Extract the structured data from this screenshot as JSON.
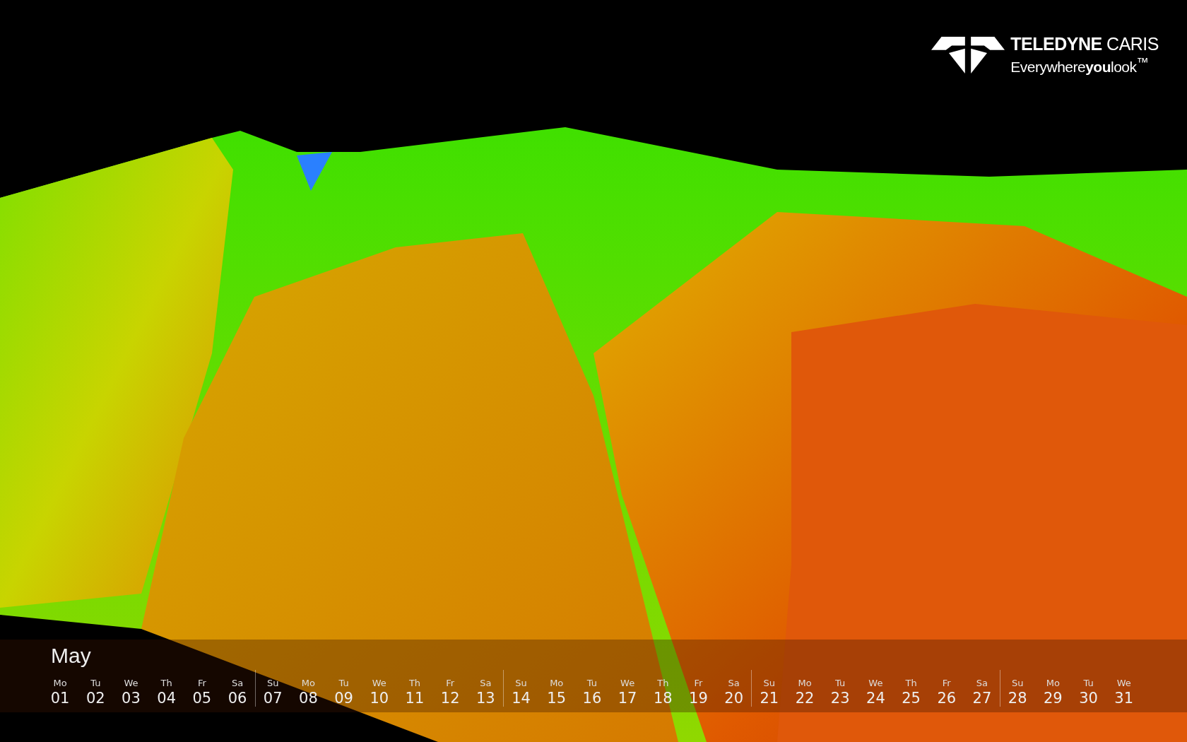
{
  "logo": {
    "name": "**TELEDYNE** CARIS",
    "tagline": "Everywhere**you**look$^{™}$"
  },
  "calendar": {
    "month": "May",
    "weeks": [
      {
        "days": [
          {
            "weekday": "Mo",
            "date": "01"
          },
          {
            "weekday": "Tu",
            "date": "02"
          },
          {
            "weekday": "We",
            "date": "03"
          },
          {
            "weekday": "Th",
            "date": "04"
          },
          {
            "weekday": "Fr",
            "date": "05"
          },
          {
            "weekday": "Sa",
            "date": "06"
          }
        ]
      },
      {
        "days": [
          {
            "weekday": "Su",
            "date": "07"
          },
          {
            "weekday": "Mo",
            "date": "08"
          },
          {
            "weekday": "Tu",
            "date": "09"
          },
          {
            "weekday": "We",
            "date": "10"
          },
          {
            "weekday": "Th",
            "date": "11"
          },
          {
            "weekday": "Fr",
            "date": "12"
          },
          {
            "weekday": "Sa",
            "date": "13"
          }
        ]
      },
      {
        "days": [
          {
            "weekday": "Su",
            "date": "14"
          },
          {
            "weekday": "Mo",
            "date": "15"
          },
          {
            "weekday": "Tu",
            "date": "16"
          },
          {
            "weekday": "We",
            "date": "17"
          },
          {
            "weekday": "Th",
            "date": "18"
          },
          {
            "weekday": "Fr",
            "date": "19"
          },
          {
            "weekday": "Sa",
            "date": "20"
          }
        ]
      },
      {
        "days": [
          {
            "weekday": "Su",
            "date": "21"
          },
          {
            "weekday": "Mo",
            "date": "22"
          },
          {
            "weekday": "Tu",
            "date": "23"
          },
          {
            "weekday": "We",
            "date": "24"
          },
          {
            "weekday": "Th",
            "date": "25"
          },
          {
            "weekday": "Fr",
            "date": "26"
          },
          {
            "weekday": "Sa",
            "date": "27"
          }
        ]
      },
      {
        "days": [
          {
            "weekday": "Su",
            "date": "28"
          },
          {
            "weekday": "Mo",
            "date": "29"
          },
          {
            "weekday": "Tu",
            "date": "30"
          },
          {
            "weekday": "We",
            "date": "31"
          }
        ]
      }
    ]
  }
}
